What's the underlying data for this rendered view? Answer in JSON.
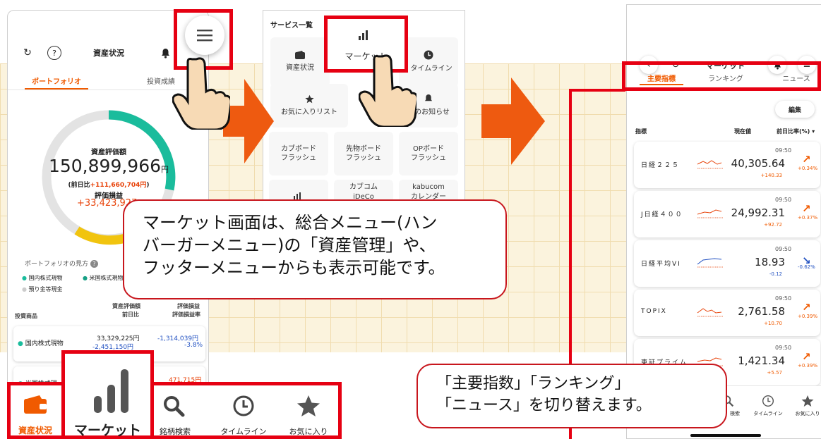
{
  "phone1": {
    "title": "資産状況",
    "tabs": [
      "ポートフォリオ",
      "投資成績"
    ],
    "total_label": "資産評価額",
    "total_value": "150,899,966",
    "total_unit": "円",
    "prev_prefix": "(前日比",
    "prev_value": "+111,660,704円",
    "prev_suffix": ")",
    "pl_label": "評価損益",
    "pl_value": "+33,423,927",
    "view_label": "ポートフォリオの見方",
    "legend": [
      "国内株式現物",
      "米国株式現物",
      "預り金等現金"
    ],
    "table_head": {
      "col1": "投資商品",
      "col2a": "資産評価額",
      "col2b": "前日比",
      "col3a": "評価損益",
      "col3b": "評価損益率"
    },
    "row1": {
      "name": "国内株式現物",
      "value": "33,329,225円",
      "change": "-2,451,150円",
      "pl": "-1,314,039円",
      "rate": "-3.8%"
    },
    "row2": {
      "name": "米国株式現",
      "pl": "471,715円"
    },
    "colors": {
      "accent": "#f05a00",
      "donut_teal": "#1abc9c",
      "donut_yellow": "#f1c40f",
      "positive": "#e8430a",
      "negative": "#1f4fc1"
    }
  },
  "footer": {
    "items": [
      "資産状況",
      "マーケット",
      "銘柄検索",
      "タイムライン",
      "お気に入り"
    ],
    "icons": [
      "wallet-icon",
      "bar-chart-icon",
      "search-icon",
      "clock-icon",
      "star-icon"
    ]
  },
  "phone2": {
    "title": "サービス一覧",
    "cards": [
      "資産状況",
      "マーケット",
      "タイムライン",
      "お気に入りリスト",
      "へのお知らせ",
      "カブボード\nフラッシュ",
      "先物ボード\nフラッシュ",
      "OPボード\nフラッシュ",
      "カブコム\niDeCo",
      "kabucom\nカレンダー"
    ]
  },
  "phone3": {
    "title": "マーケット",
    "tabs": [
      "主要指標",
      "ランキング",
      "ニュース"
    ],
    "edit_label": "編集",
    "head": {
      "col1": "指標",
      "col2": "現在値",
      "col3": "前日比率(%) ▾"
    },
    "indices": [
      {
        "name": "日経２２５",
        "time": "09:50",
        "value": "40,305.64",
        "change": "+140.33",
        "pct": "+0.34%",
        "dir": "up"
      },
      {
        "name": "J日経４００",
        "time": "09:50",
        "value": "24,992.31",
        "change": "+92.72",
        "pct": "+0.37%",
        "dir": "up"
      },
      {
        "name": "日経平均VI",
        "time": "09:50",
        "value": "18.93",
        "change": "-0.12",
        "pct": "-0.62%",
        "dir": "down"
      },
      {
        "name": "TOPIX",
        "time": "09:50",
        "value": "2,761.58",
        "change": "+10.70",
        "pct": "+0.39%",
        "dir": "up"
      },
      {
        "name": "東証プライム",
        "time": "09:50",
        "value": "1,421.34",
        "change": "+5.57",
        "pct": "+0.39%",
        "dir": "up"
      }
    ],
    "footer": [
      "検索",
      "タイムライン",
      "お気に入り"
    ]
  },
  "callouts": {
    "menu_note": "マーケット画面は、総合メニュー(ハンバーガーメニュー)の「資産管理」や、フッターメニューからも表示可能です。",
    "menu_note_lines": [
      "マーケット画面は、総合メニュー(ハン",
      "バーガーメニュー)の「資産管理」や、",
      "フッターメニューからも表示可能です。"
    ],
    "tab_note_lines": [
      "「主要指数」「ランキング」",
      "「ニュース」を切り替えます。"
    ]
  }
}
